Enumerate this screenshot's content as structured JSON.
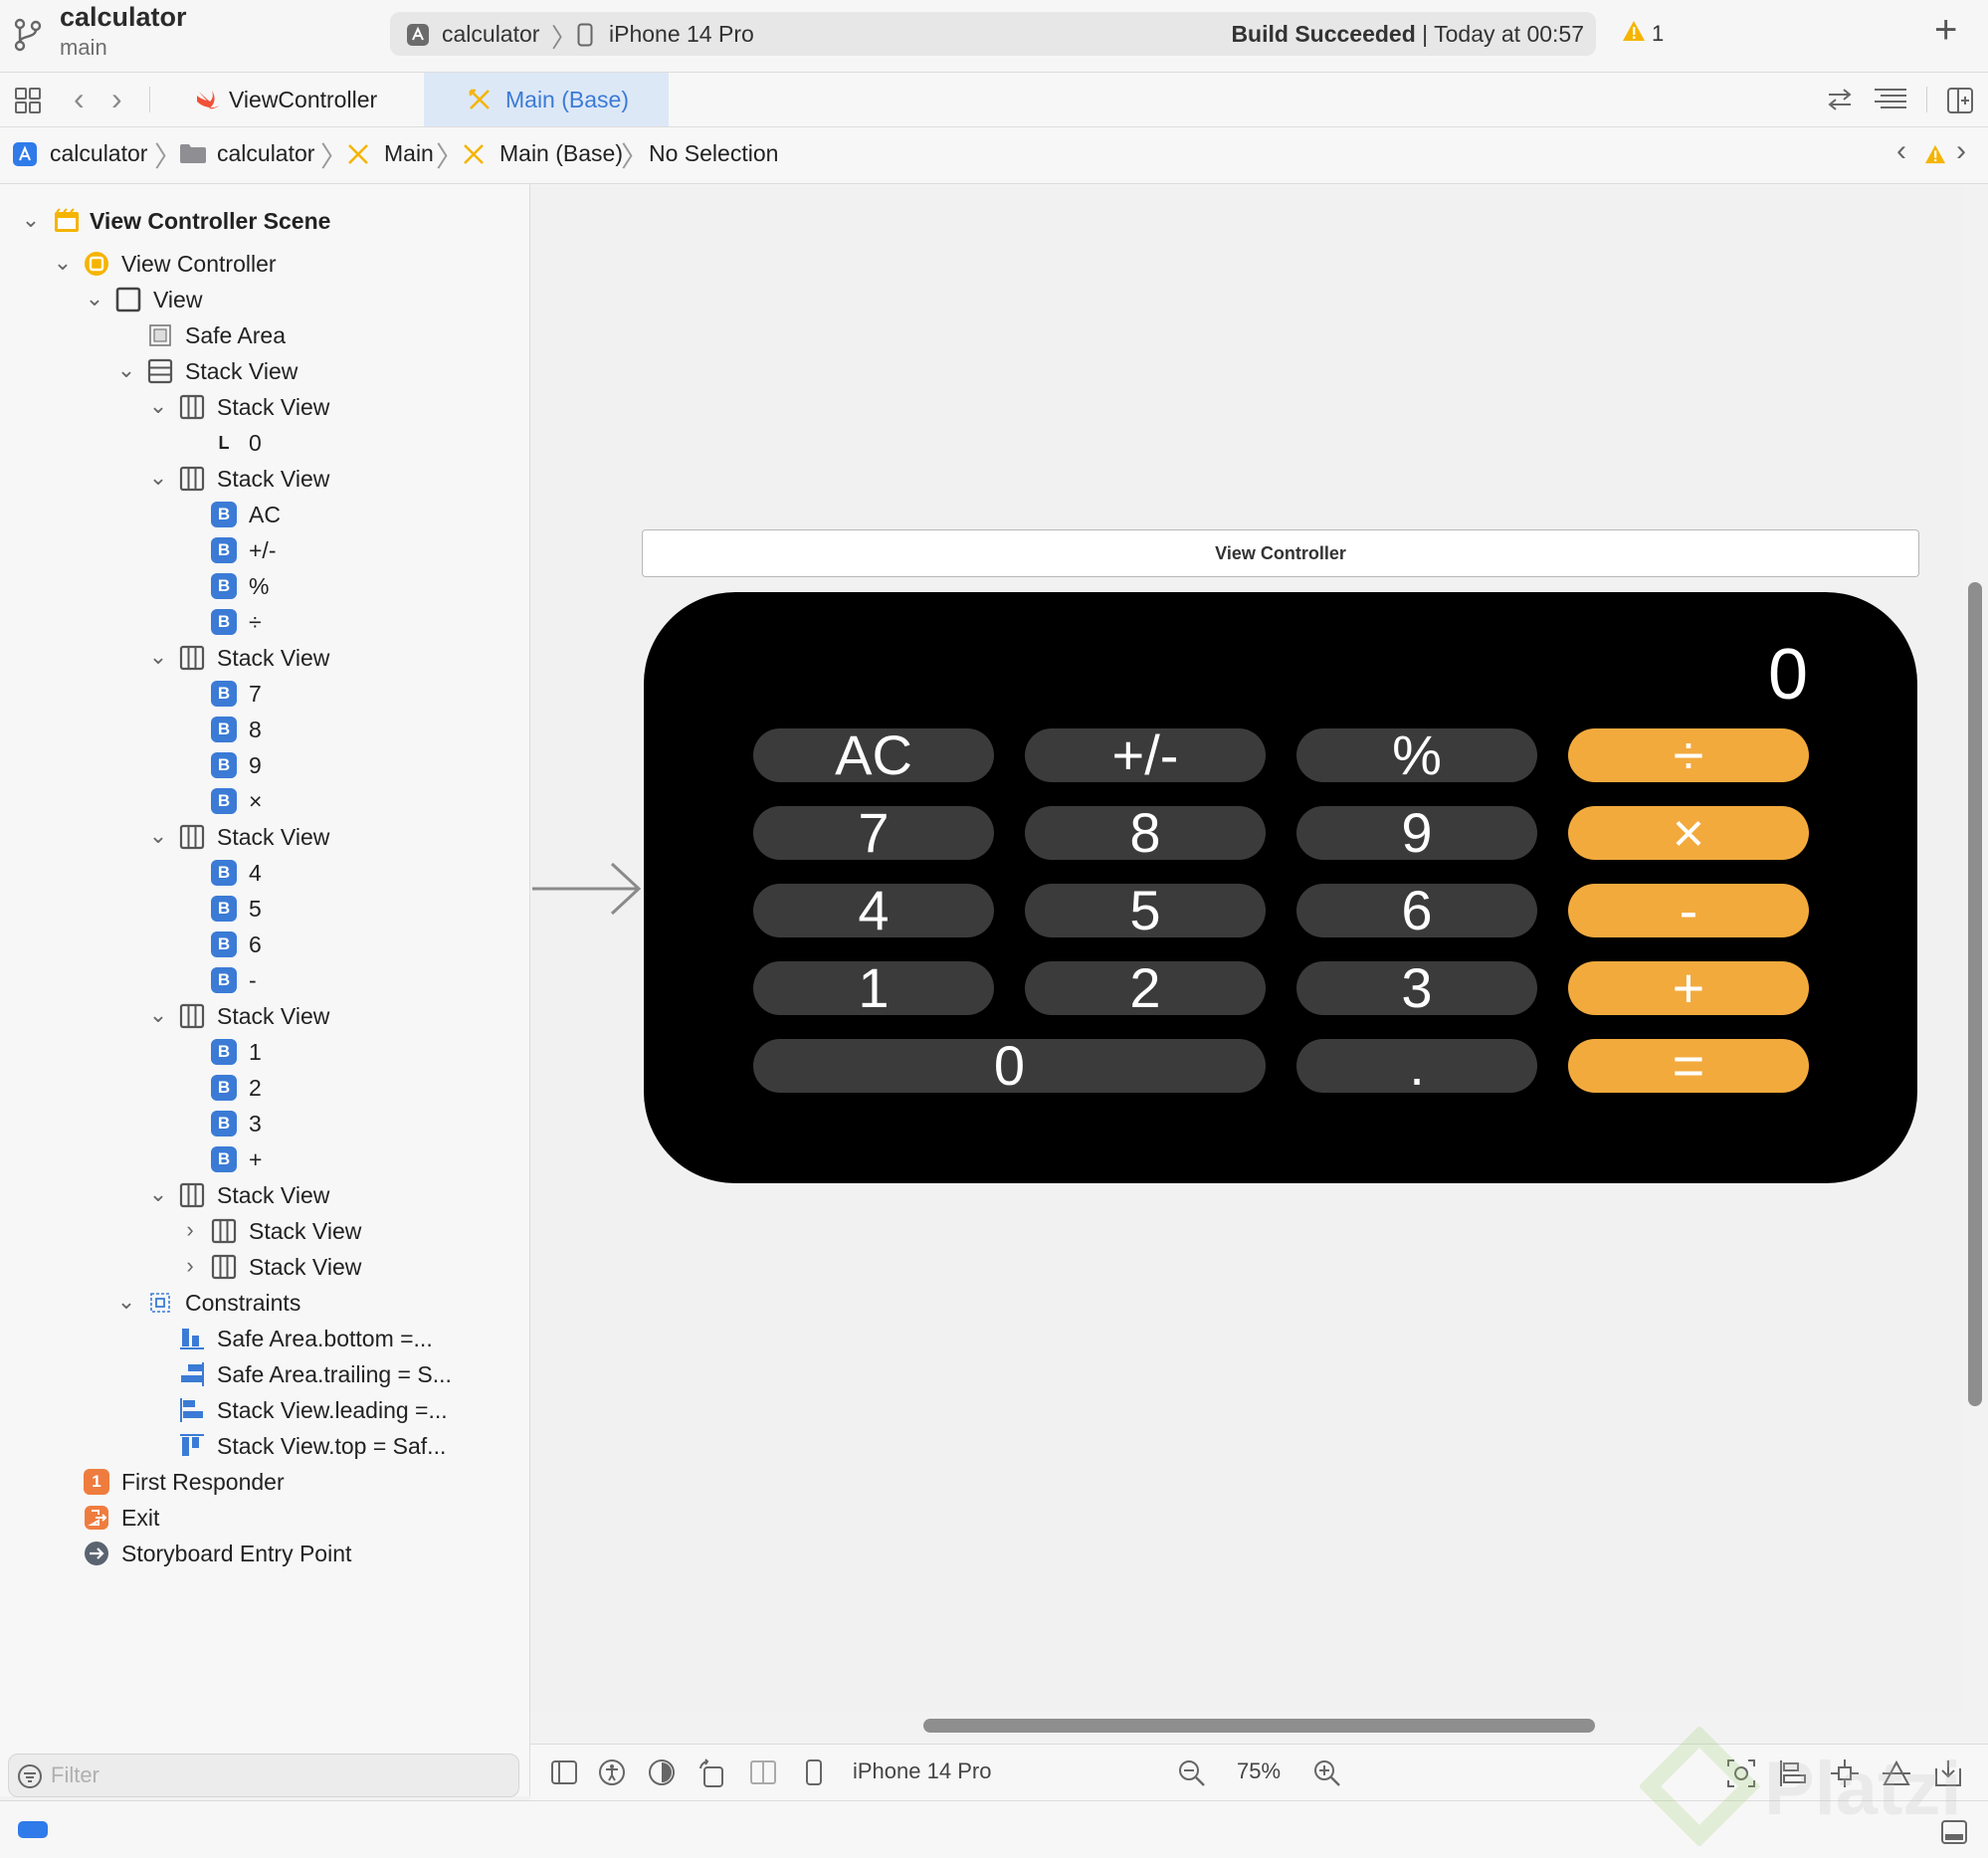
{
  "toolbar": {
    "project": "calculator",
    "branch": "main",
    "scheme": "calculator",
    "device": "iPhone 14 Pro",
    "build_status_bold": "Build Succeeded",
    "build_status_rest": " | Today at 00:57",
    "warning_count": "1",
    "add_label": "+"
  },
  "tabs": [
    {
      "label": "ViewController",
      "icon": "swift-icon"
    },
    {
      "label": "Main (Base)",
      "icon": "storyboard-icon",
      "active": true
    }
  ],
  "pathbar": {
    "crumbs": [
      "calculator",
      "calculator",
      "Main",
      "Main (Base)",
      "No Selection"
    ]
  },
  "outline": {
    "scene": "View Controller Scene",
    "view_controller": "View Controller",
    "view": "View",
    "safe_area": "Safe Area",
    "stack_view": "Stack View",
    "display_label": "0",
    "row1": [
      "AC",
      "+/-",
      "%",
      "÷"
    ],
    "row2": [
      "7",
      "8",
      "9",
      "×"
    ],
    "row3": [
      "4",
      "5",
      "6",
      "-"
    ],
    "row4": [
      "1",
      "2",
      "3",
      "+"
    ],
    "constraints": "Constraints",
    "constraint_items": [
      "Safe Area.bottom =...",
      "Safe Area.trailing = S...",
      "Stack View.leading =...",
      "Stack View.top = Saf..."
    ],
    "first_responder": "First Responder",
    "first_responder_badge": "1",
    "exit": "Exit",
    "entry_point": "Storyboard Entry Point",
    "badge_button": "B",
    "badge_label": "L",
    "filter_placeholder": "Filter"
  },
  "canvas": {
    "scene_title": "View Controller",
    "display": "0",
    "keys": [
      {
        "label": "AC",
        "type": "func"
      },
      {
        "label": "+/-",
        "type": "func"
      },
      {
        "label": "%",
        "type": "func"
      },
      {
        "label": "÷",
        "type": "op"
      },
      {
        "label": "7",
        "type": "num"
      },
      {
        "label": "8",
        "type": "num"
      },
      {
        "label": "9",
        "type": "num"
      },
      {
        "label": "×",
        "type": "op"
      },
      {
        "label": "4",
        "type": "num"
      },
      {
        "label": "5",
        "type": "num"
      },
      {
        "label": "6",
        "type": "num"
      },
      {
        "label": "-",
        "type": "op"
      },
      {
        "label": "1",
        "type": "num"
      },
      {
        "label": "2",
        "type": "num"
      },
      {
        "label": "3",
        "type": "num"
      },
      {
        "label": "+",
        "type": "op"
      },
      {
        "label": "0",
        "type": "num"
      },
      {
        "label": ".",
        "type": "num"
      },
      {
        "label": "=",
        "type": "op"
      }
    ],
    "colors": {
      "keypad_gray": "#3b3b3b",
      "operator_orange": "#f2aa3d",
      "device_bg": "#000000"
    }
  },
  "canvas_bar": {
    "device": "iPhone 14 Pro",
    "zoom": "75%"
  },
  "colors": {
    "accent": "#3b7bd6",
    "warning": "#f5b400"
  }
}
